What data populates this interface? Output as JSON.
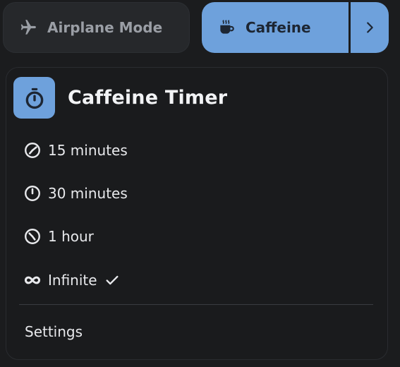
{
  "quick_settings": {
    "airplane": {
      "label": "Airplane Mode",
      "icon": "airplane-icon",
      "active": false
    },
    "caffeine": {
      "label": "Caffeine",
      "icon": "coffee-cup-icon",
      "active": true,
      "expand_icon": "chevron-right-icon"
    }
  },
  "menu": {
    "title": "Caffeine Timer",
    "title_icon": "stopwatch-icon",
    "items": [
      {
        "label": "15 minutes",
        "icon": "timer-quarter-icon",
        "selected": false
      },
      {
        "label": "30 minutes",
        "icon": "timer-half-icon",
        "selected": false
      },
      {
        "label": "1 hour",
        "icon": "timer-full-icon",
        "selected": false
      },
      {
        "label": "Infinite",
        "icon": "infinity-icon",
        "selected": true,
        "selected_icon": "checkmark-icon"
      }
    ],
    "settings_label": "Settings"
  },
  "colors": {
    "accent": "#6ea1dc",
    "background": "#1b1c1e",
    "inactive_pill": "#26282b",
    "text": "#e8e9ec"
  }
}
